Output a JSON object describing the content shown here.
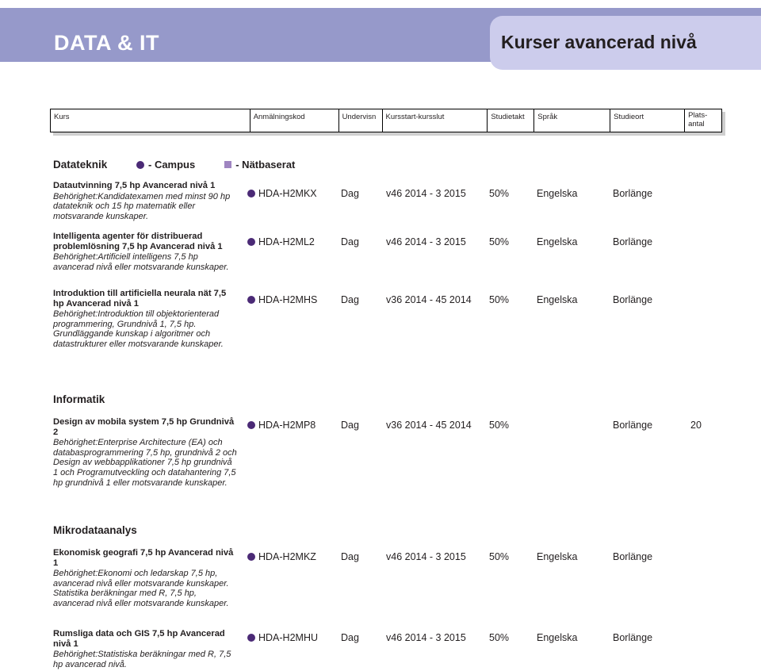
{
  "header": {
    "title": "DATA & IT",
    "chip_label": "Kurser avancerad nivå",
    "bar_color": "#9699ca",
    "chip_color": "#ccccec"
  },
  "columns": {
    "kurs": "Kurs",
    "anmalningskod": "Anmälningskod",
    "undervisn": "Undervisn",
    "kursstart": "Kursstart-kursslut",
    "studietakt": "Studietakt",
    "sprak": "Språk",
    "studieort": "Studieort",
    "platsantal": "Plats-\nantal"
  },
  "legend": {
    "campus_label": "- Campus",
    "natbaserat_label": "- Nätbaserat",
    "campus_color": "#4b2a76",
    "natbaserat_color": "#9f85c1"
  },
  "sections": [
    {
      "name": "Datateknik",
      "courses": [
        {
          "title": "Datautvinning 7,5 hp Avancerad nivå 1",
          "requirement": "Behörighet:Kandidatexamen med minst 90 hp datateknik och 15 hp matematik eller motsvarande kunskaper.",
          "row": {
            "marker": "campus",
            "code": "HDA-H2MKX",
            "undervisn": "Dag",
            "period": "v46 2014 - 3 2015",
            "studietakt": "50%",
            "sprak": "Engelska",
            "studieort": "Borlänge",
            "platsantal": ""
          }
        },
        {
          "title": "Intelligenta agenter för distribuerad problemlösning 7,5 hp Avancerad nivå 1",
          "requirement": "Behörighet:Artificiell intelligens 7,5 hp avancerad nivå eller motsvarande kunskaper.",
          "row": {
            "marker": "campus",
            "code": "HDA-H2ML2",
            "undervisn": "Dag",
            "period": "v46 2014 - 3 2015",
            "studietakt": "50%",
            "sprak": "Engelska",
            "studieort": "Borlänge",
            "platsantal": ""
          }
        },
        {
          "title": "Introduktion till artificiella neurala nät 7,5 hp Avancerad nivå 1",
          "requirement": "Behörighet:Introduktion till objektorienterad programmering, Grundnivå 1, 7,5 hp. Grundläggande kunskap i algoritmer och datastrukturer eller motsvarande kunskaper.",
          "row": {
            "marker": "campus",
            "code": "HDA-H2MHS",
            "undervisn": "Dag",
            "period": "v36 2014 - 45 2014",
            "studietakt": "50%",
            "sprak": "Engelska",
            "studieort": "Borlänge",
            "platsantal": ""
          }
        }
      ]
    },
    {
      "name": "Informatik",
      "courses": [
        {
          "title": "Design av mobila system 7,5 hp Grundnivå 2",
          "requirement": "Behörighet:Enterprise Architecture (EA) och databasprogrammering 7,5 hp, grundnivå 2 och Design av webbapplikationer 7,5 hp grundnivå 1 och Programutveckling och datahantering 7,5 hp grundnivå 1 eller motsvarande kunskaper.",
          "row": {
            "marker": "campus",
            "code": "HDA-H2MP8",
            "undervisn": "Dag",
            "period": "v36 2014 - 45 2014",
            "studietakt": "50%",
            "sprak": "",
            "studieort": "Borlänge",
            "platsantal": "20"
          }
        }
      ]
    },
    {
      "name": "Mikrodataanalys",
      "courses": [
        {
          "title": "Ekonomisk geografi 7,5 hp Avancerad nivå 1",
          "requirement": "Behörighet:Ekonomi och ledarskap 7,5 hp, avancerad nivå eller motsvarande kunskaper. Statistika beräkningar med R, 7,5 hp, avancerad nivå eller motsvarande kunskaper.",
          "row": {
            "marker": "campus",
            "code": "HDA-H2MKZ",
            "undervisn": "Dag",
            "period": "v46 2014 - 3 2015",
            "studietakt": "50%",
            "sprak": "Engelska",
            "studieort": "Borlänge",
            "platsantal": ""
          }
        },
        {
          "title": "Rumsliga data och GIS 7,5 hp Avancerad nivå 1",
          "requirement": "Behörighet:Statistiska beräkningar med R, 7,5 hp avancerad nivå.",
          "row": {
            "marker": "campus",
            "code": "HDA-H2MHU",
            "undervisn": "Dag",
            "period": "v46 2014 - 3 2015",
            "studietakt": "50%",
            "sprak": "Engelska",
            "studieort": "Borlänge",
            "platsantal": ""
          }
        }
      ]
    }
  ]
}
